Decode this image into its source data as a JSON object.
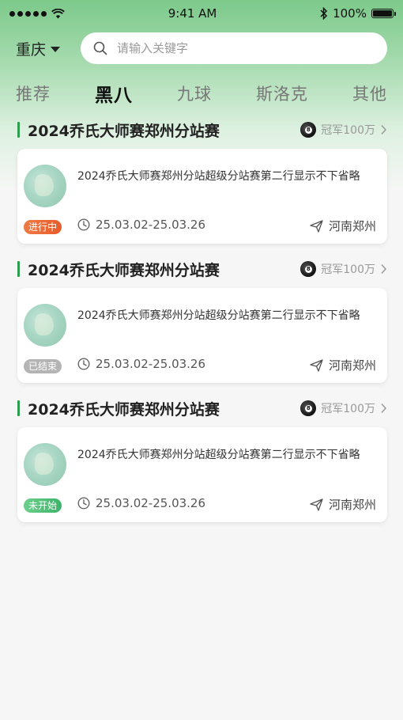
{
  "status_bar": {
    "time": "9:41 AM",
    "battery": "100%"
  },
  "header": {
    "city": "重庆",
    "search_placeholder": "请输入关键字"
  },
  "tabs": [
    {
      "label": "推荐",
      "active": false
    },
    {
      "label": "黑八",
      "active": true
    },
    {
      "label": "九球",
      "active": false
    },
    {
      "label": "斯洛克",
      "active": false
    },
    {
      "label": "其他",
      "active": false
    }
  ],
  "ball_number": "8",
  "sections": [
    {
      "title": "2024乔氏大师赛郑州分站赛",
      "prize": "冠军100万",
      "card": {
        "title": "2024乔氏大师赛郑州分站超级分站赛第二行显示不下省略",
        "status": "进行中",
        "date": "25.03.02-25.03.26",
        "location": "河南郑州"
      }
    },
    {
      "title": "2024乔氏大师赛郑州分站赛",
      "prize": "冠军100万",
      "card": {
        "title": "2024乔氏大师赛郑州分站超级分站赛第二行显示不下省略",
        "status": "已结束",
        "date": "25.03.02-25.03.26",
        "location": "河南郑州"
      }
    },
    {
      "title": "2024乔氏大师赛郑州分站赛",
      "prize": "冠军100万",
      "card": {
        "title": "2024乔氏大师赛郑州分站超级分站赛第二行显示不下省略",
        "status": "未开始",
        "date": "25.03.02-25.03.26",
        "location": "河南郑州"
      }
    }
  ],
  "colors": {
    "accent": "#2e9e4e",
    "status_ongoing": "#e85c2a",
    "status_ended": "#b4b4b4",
    "status_upcoming": "#3db36a"
  }
}
